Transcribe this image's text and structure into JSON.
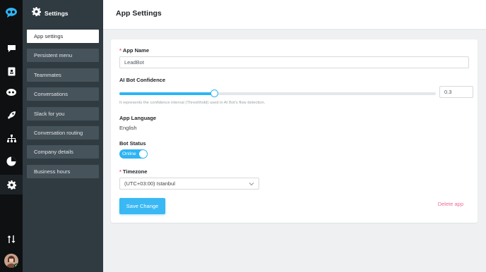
{
  "sidebar": {
    "title": "Settings",
    "items": [
      {
        "label": "App settings",
        "active": true
      },
      {
        "label": "Persistent menu"
      },
      {
        "label": "Teammates"
      },
      {
        "label": "Conversations"
      },
      {
        "label": "Slack for you"
      },
      {
        "label": "Conversation routing"
      },
      {
        "label": "Company details"
      },
      {
        "label": "Business hours"
      }
    ]
  },
  "rail": {
    "icons": [
      "logo-icon",
      "chat-icon",
      "contacts-icon",
      "bot-icon",
      "rocket-icon",
      "hierarchy-icon",
      "reports-icon",
      "settings-icon",
      "sort-icon"
    ]
  },
  "header": {
    "title": "App Settings"
  },
  "form": {
    "app_name": {
      "required_mark": "*",
      "label": "App Name",
      "value": "LeadBot"
    },
    "confidence": {
      "label": "AI Bot Confidence",
      "value": "0.3",
      "fraction": 0.3,
      "hint": "It represents the confidence interval (Threshhold) used in AI Bot's flow detection."
    },
    "language": {
      "label": "App Language",
      "value": "English"
    },
    "bot_status": {
      "label": "Bot Status",
      "value": "Online"
    },
    "timezone": {
      "required_mark": "*",
      "label": "Timezone",
      "value": "(UTC+03:00) Istanbul"
    },
    "save_label": "Save Change",
    "delete_label": "Delete app"
  },
  "colors": {
    "accent": "#2fb4f3",
    "danger": "#f06b96",
    "sidebar": "#2f3a41",
    "rail": "#0e1012"
  }
}
